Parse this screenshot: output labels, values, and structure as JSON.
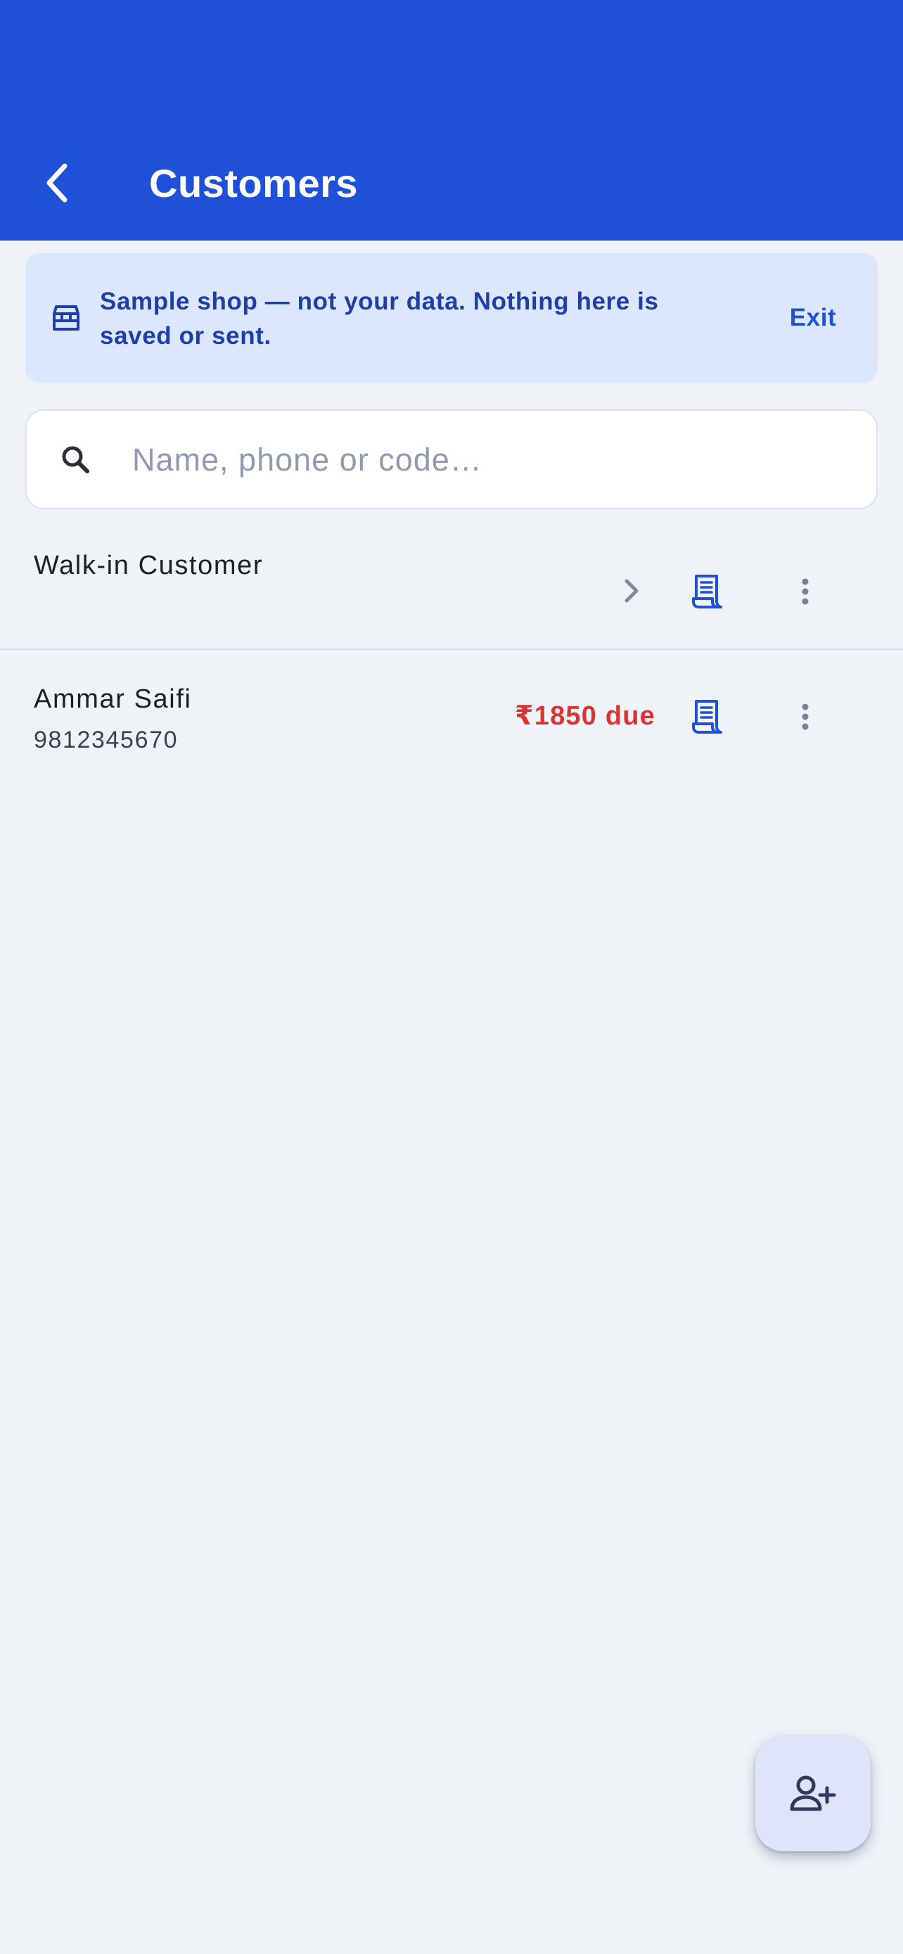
{
  "header": {
    "title": "Customers",
    "background_color": "#1f51d8",
    "back_icon": "chevron-left-icon"
  },
  "banner": {
    "icon": "storefront-icon",
    "message": "Sample shop — not your data. Nothing here is saved or sent.",
    "exit_label": "Exit",
    "background_color": "#dbe7fd"
  },
  "search": {
    "icon": "search-icon",
    "placeholder": "Name, phone or code…",
    "value": ""
  },
  "customers": [
    {
      "name": "Walk-in Customer",
      "phone": "",
      "due": "",
      "actions": [
        "chevron-right-icon",
        "receipt-icon",
        "more-vertical-icon"
      ]
    },
    {
      "name": "Ammar Saifi",
      "phone": "9812345670",
      "due": "₹1850 due",
      "due_color": "#d93434",
      "actions": [
        "receipt-icon",
        "more-vertical-icon"
      ]
    }
  ],
  "fab": {
    "icon": "add-person-icon"
  }
}
